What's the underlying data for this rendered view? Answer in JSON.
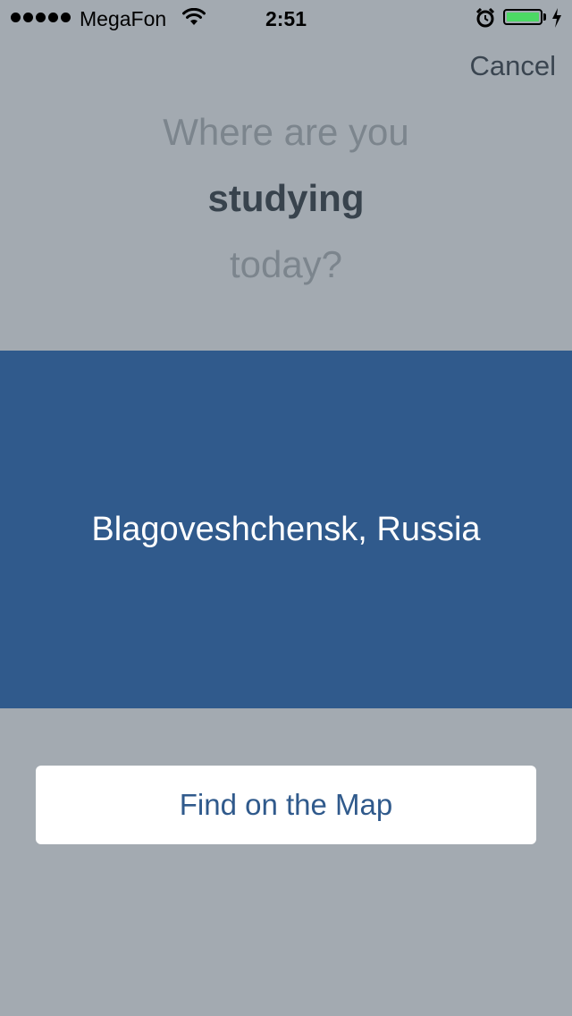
{
  "status_bar": {
    "carrier": "MegaFon",
    "time": "2:51",
    "signal_bars": 5,
    "battery_color": "#4cd964",
    "icons": [
      "signal-dots-icon",
      "wifi-icon",
      "alarm-icon",
      "battery-icon",
      "charging-bolt-icon"
    ]
  },
  "nav": {
    "cancel_label": "Cancel"
  },
  "prompt": {
    "line1": "Where are you",
    "line2": "studying",
    "line3": "today?"
  },
  "location": {
    "name": "Blagoveshchensk, Russia",
    "band_color": "#305a8c"
  },
  "actions": {
    "find_on_map_label": "Find on the Map"
  },
  "colors": {
    "background": "#a3aab1",
    "accent": "#305a8c"
  }
}
